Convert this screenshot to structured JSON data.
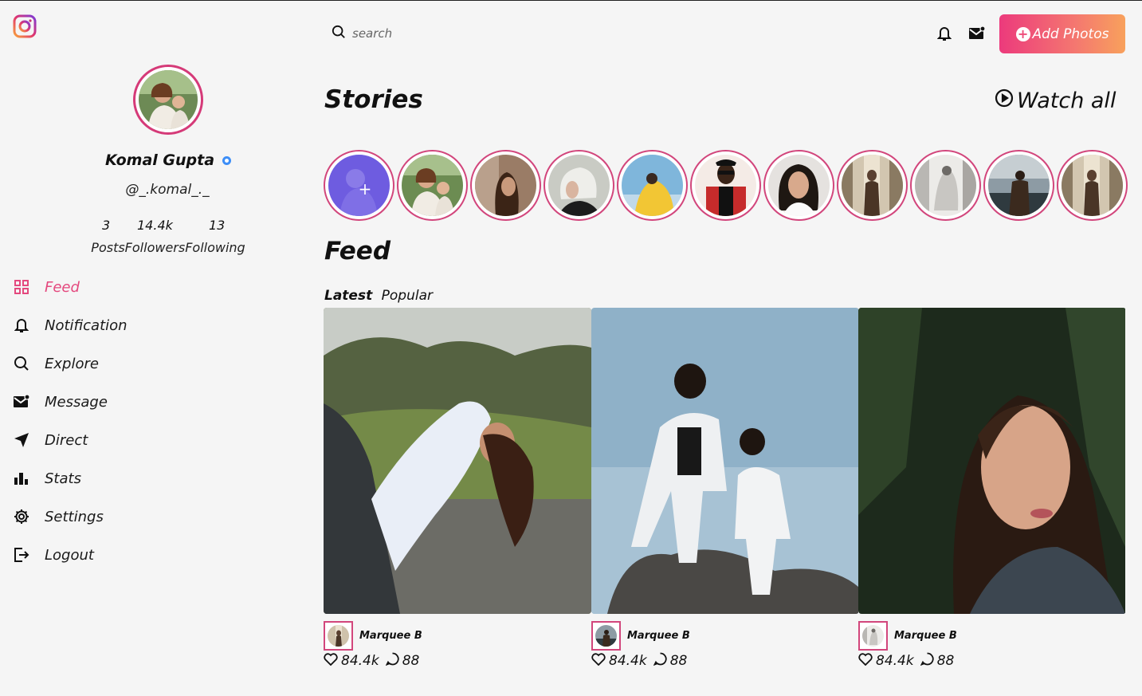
{
  "search": {
    "placeholder": "search"
  },
  "header": {
    "add_photos_label": "Add Photos"
  },
  "profile": {
    "name": "Komal Gupta",
    "handle": "@_.komal_._",
    "stats": {
      "posts": "3",
      "followers": "14.4k",
      "following": "13"
    },
    "stats_labels": "PostsFollowersFollowing"
  },
  "sidebar": {
    "items": [
      {
        "label": "Feed",
        "icon": "grid-icon",
        "active": true
      },
      {
        "label": "Notification",
        "icon": "bell-icon"
      },
      {
        "label": "Explore",
        "icon": "search-icon"
      },
      {
        "label": "Message",
        "icon": "mail-icon"
      },
      {
        "label": "Direct",
        "icon": "send-icon"
      },
      {
        "label": "Stats",
        "icon": "bar-chart-icon"
      },
      {
        "label": "Settings",
        "icon": "gear-icon"
      },
      {
        "label": "Logout",
        "icon": "logout-icon"
      }
    ]
  },
  "stories": {
    "title": "Stories",
    "watch_all": "Watch all",
    "add_icon": "plus-icon"
  },
  "feed": {
    "title": "Feed",
    "tabs": [
      "Latest",
      "Popular"
    ],
    "active_tab": "Latest",
    "posts": [
      {
        "author": "Marquee B",
        "likes": "84.4k",
        "comments": "88"
      },
      {
        "author": "Marquee B",
        "likes": "84.4k",
        "comments": "88"
      },
      {
        "author": "Marquee B",
        "likes": "84.4k",
        "comments": "88"
      }
    ]
  },
  "colors": {
    "accent": "#e4497e",
    "story_ring": "#d2467c",
    "gradient_start": "#ec3a7c",
    "gradient_end": "#f8a15c",
    "verified": "#3d8ef7"
  }
}
